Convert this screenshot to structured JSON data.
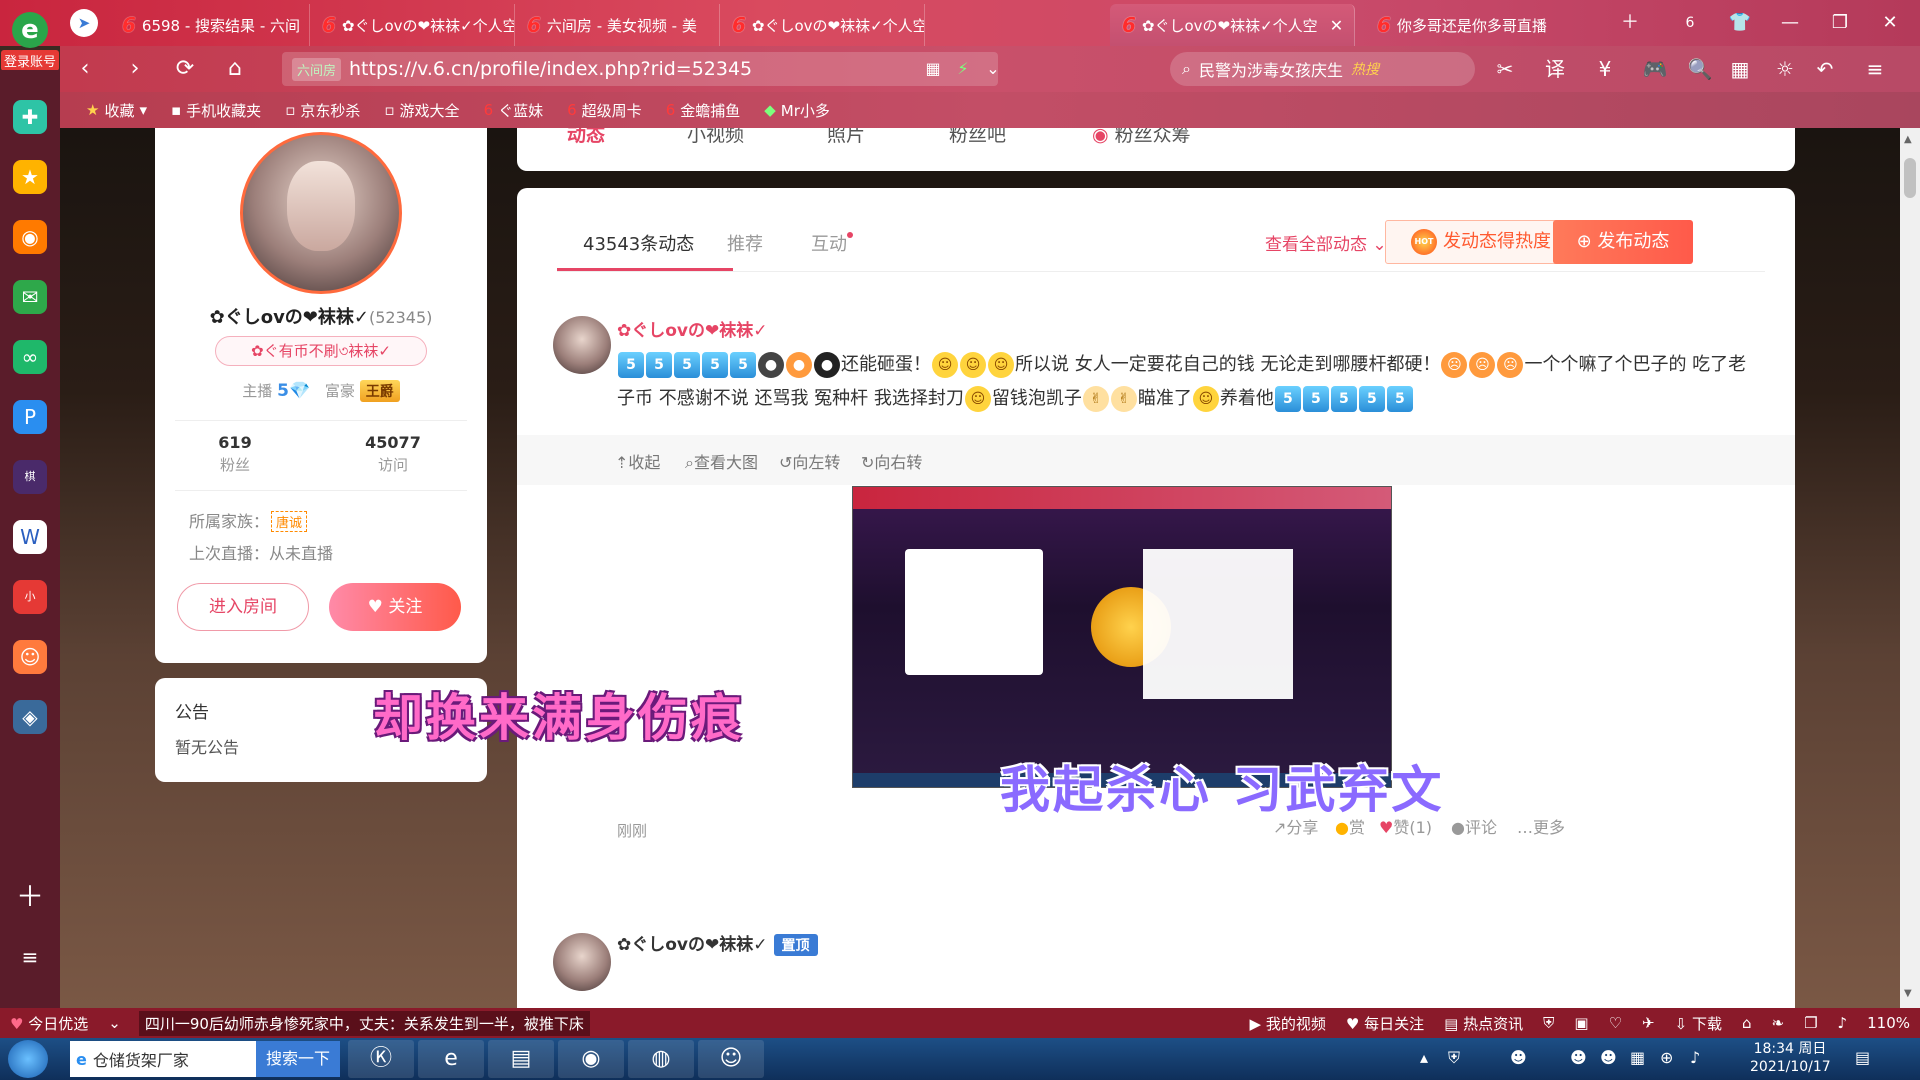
{
  "browser": {
    "login_label": "登录账号",
    "tabs": [
      {
        "label": "6598 - 搜索结果 - 六间"
      },
      {
        "label": "✿ぐしovの❤袜袜✓个人空"
      },
      {
        "label": "六间房 - 美女视频 - 美"
      },
      {
        "label": "✿ぐしovの❤袜袜✓个人空"
      },
      {
        "label": "✿ぐしovの❤袜袜✓个人空"
      },
      {
        "label": "你多哥还是你多哥直播"
      }
    ],
    "tab_count": "6",
    "url_secure_label": "六间房",
    "url": "https://v.6.cn/profile/index.php?rid=52345",
    "search_text": "民警为涉毒女孩庆生",
    "search_hot": "热搜",
    "bookmarks": [
      "收藏",
      "手机收藏夹",
      "京东秒杀",
      "游戏大全",
      "ぐ蓝妹",
      "超级周卡",
      "金蟾捕鱼",
      "Mr小多"
    ]
  },
  "profile": {
    "name": "✿ぐしovの❤袜袜✓",
    "uid": "(52345)",
    "signature": "✿ぐ有币不刷৩袜袜✓",
    "anchor_label": "主播",
    "anchor_level": "5",
    "rich_label": "富豪",
    "rich_badge": "王爵",
    "fans_count": "619",
    "fans_label": "粉丝",
    "visits_count": "45077",
    "visits_label": "访问",
    "family_label": "所属家族：",
    "family_value": "唐诚",
    "last_live": "上次直播：从未直播",
    "enter_room": "进入房间",
    "follow": "关注"
  },
  "notice": {
    "title": "公告",
    "content": "暂无公告"
  },
  "top_nav": [
    "动态",
    "小视频",
    "照片",
    "粉丝吧",
    "粉丝众筹"
  ],
  "feed": {
    "tabs": [
      "43543条动态",
      "推荐",
      "互动"
    ],
    "view_all": "查看全部动态",
    "hot_button": "发动态得热度",
    "publish_button": "发布动态",
    "post1": {
      "author": "✿ぐしovの❤袜袜✓",
      "text_a": "还能砸蛋！",
      "text_b": "所以说 女人一定要花自己的钱 无论走到哪腰杆都硬！",
      "text_c": "一个个嘛了个巴子的 吃了老子币 不感谢不说 还骂我 冤种杆 我选择封刀",
      "text_d": "留钱泡凯子",
      "text_e": "瞄准了",
      "text_f": "养着他",
      "tools": [
        "收起",
        "查看大图",
        "向左转",
        "向右转"
      ],
      "time": "刚刚",
      "actions": [
        "分享",
        "赏",
        "赞(1)",
        "评论",
        "更多"
      ]
    },
    "post2": {
      "author": "✿ぐしovの❤袜袜✓",
      "pin": "置顶"
    }
  },
  "lyrics": {
    "line1": "却换来满身伤痕",
    "line2": "我起杀心  习武弃文"
  },
  "status_strip": {
    "today": "今日优选",
    "news": "四川一90后幼师赤身惨死家中，丈夫：关系发生到一半，被推下床",
    "items": [
      "我的视频",
      "每日关注",
      "热点资讯",
      "下载"
    ],
    "zoom": "110%"
  },
  "taskbar": {
    "search_text": "仓储货架厂家",
    "search_button": "搜索一下",
    "time": "18:34 周日",
    "date": "2021/10/17"
  },
  "colors": {
    "accent": "#e64565",
    "tabbar": "#c9253e",
    "publish": "#ff5a4a"
  }
}
